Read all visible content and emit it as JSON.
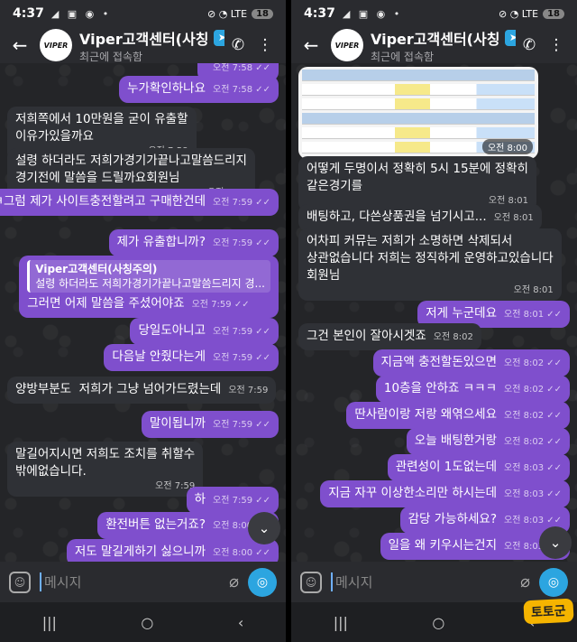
{
  "status": {
    "time": "4:37",
    "icons": "◢ ▣ ◉ •",
    "net": "⊘ ◔ LTE",
    "battery": "18"
  },
  "header": {
    "contact_name": "Viper고객센터(사칭",
    "subtitle": "최근에 접속함",
    "avatar_text": "VIPER"
  },
  "composer": {
    "placeholder": "메시지"
  },
  "left": {
    "messages": [
      {
        "dir": "out",
        "text": "",
        "time": "오전 7:58",
        "ticks": "✓✓"
      },
      {
        "dir": "out",
        "text": "누가확인하나요",
        "time": "오전 7:58",
        "ticks": "✓✓"
      },
      {
        "dir": "in",
        "text": "저희쪽에서 10만원을 굳이 유출할\n이유가있을까요",
        "time": "오전 7:58"
      },
      {
        "dir": "in",
        "text": "설령 하더라도 저희가경기가끝나고말씀드리지\n경기전에 말씀을 드릴까요회원님",
        "time": "오전 7:59"
      },
      {
        "dir": "out",
        "text": "ㅋㅋㅋㅋ그럼 제가 사이트충전할려고 구매한건데",
        "time": "오전 7:59",
        "ticks": "✓✓"
      },
      {
        "dir": "out",
        "text": "제가 유출합니까?",
        "time": "오전 7:59",
        "ticks": "✓✓"
      },
      {
        "dir": "out",
        "quote_name": "Viper고객센터(사칭주의)",
        "quote_text": "설령 하더라도 저희가경기가끝나고말씀드리지 경...",
        "text": "그러면 어제 말씀을 주셨어야죠",
        "time": "오전 7:59",
        "ticks": "✓✓"
      },
      {
        "dir": "out",
        "text": "당일도아니고",
        "time": "오전 7:59",
        "ticks": "✓✓"
      },
      {
        "dir": "out",
        "text": "다음날 안줬다는게",
        "time": "오전 7:59",
        "ticks": "✓✓"
      },
      {
        "dir": "in",
        "text": "양방부분도  저희가 그냥 넘어가드렸는데",
        "time": "오전 7:59"
      },
      {
        "dir": "out",
        "text": "말이됩니까",
        "time": "오전 7:59",
        "ticks": "✓✓"
      },
      {
        "dir": "in",
        "text": "말길어지시면 저희도 조치를 취할수\n밖에없습니다.",
        "time": "오전 7:59"
      },
      {
        "dir": "out",
        "text": "하",
        "time": "오전 7:59",
        "ticks": "✓✓"
      },
      {
        "dir": "out",
        "text": "환전버튼 없는거죠?",
        "time": "오전 8:00",
        "ticks": "✓✓"
      },
      {
        "dir": "out",
        "text": "저도 말길게하기 싫으니까",
        "time": "오전 8:00",
        "ticks": "✓✓"
      }
    ]
  },
  "right": {
    "image_time": "오전 8:00",
    "messages": [
      {
        "dir": "in",
        "text": "어떻게 두명이서 정확히 5시 15분에 정확히\n같은경기를",
        "time": "오전 8:01"
      },
      {
        "dir": "in",
        "text": "배팅하고, 다쓴상품권을 넘기시고...",
        "time": "오전 8:01"
      },
      {
        "dir": "in",
        "text": "어차피 커뮤는 저희가 소명하면 삭제되서\n상관없습니다 저희는 정직하게 운영하고있습니다\n회원님",
        "time": "오전 8:01"
      },
      {
        "dir": "out",
        "text": "저게 누군데요",
        "time": "오전 8:01",
        "ticks": "✓✓"
      },
      {
        "dir": "in",
        "text": "그건 본인이 잘아시겟죠",
        "time": "오전 8:02"
      },
      {
        "dir": "out",
        "text": "지금액 충전할돈있으면",
        "time": "오전 8:02",
        "ticks": "✓✓"
      },
      {
        "dir": "out",
        "text": "10층을 안하죠 ㅋㅋㅋ",
        "time": "오전 8:02",
        "ticks": "✓✓"
      },
      {
        "dir": "out",
        "text": "딴사람이랑 저랑 왜엮으세요",
        "time": "오전 8:02",
        "ticks": "✓✓"
      },
      {
        "dir": "out",
        "text": "오늘 배팅한거랑",
        "time": "오전 8:02",
        "ticks": "✓✓"
      },
      {
        "dir": "out",
        "text": "관련성이 1도없는데",
        "time": "오전 8:03",
        "ticks": "✓✓"
      },
      {
        "dir": "out",
        "text": "지금 자꾸 이상한소리만 하시는데",
        "time": "오전 8:03",
        "ticks": "✓✓"
      },
      {
        "dir": "out",
        "text": "감당 가능하세요?",
        "time": "오전 8:03",
        "ticks": "✓✓"
      },
      {
        "dir": "out",
        "text": "일을 왜 키우시는건지",
        "time": "오전 8:03",
        "ticks": "✓✓"
      }
    ]
  },
  "watermark": "토토군"
}
